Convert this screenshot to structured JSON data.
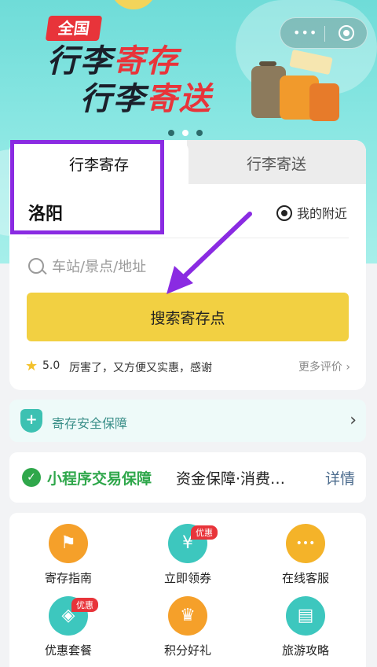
{
  "banner": {
    "badge": "全国",
    "line1_a": "行李",
    "line1_b": "寄存",
    "line2_a": "行李",
    "line2_b": "寄送",
    "slide_count": 3,
    "active_slide": 1
  },
  "capsule": {
    "more": "•••",
    "close_icon": "target-icon"
  },
  "tabs": [
    {
      "label": "行李寄存",
      "active": true
    },
    {
      "label": "行李寄送",
      "active": false
    }
  ],
  "location": {
    "city": "洛阳",
    "nearby_label": "我的附近"
  },
  "search": {
    "placeholder": "车站/景点/地址",
    "button_label": "搜索寄存点"
  },
  "rating": {
    "score": "5.0",
    "comment": "厉害了，又方便又实惠，感谢",
    "more": "更多评价 ›"
  },
  "safety": {
    "label": "寄存安全保障"
  },
  "guarantee": {
    "title": "小程序交易保障",
    "desc": "资金保障·消费…",
    "detail": "详情"
  },
  "grid": [
    {
      "label": "寄存指南",
      "icon": "signpost-icon",
      "glyph": "⚑",
      "badge": ""
    },
    {
      "label": "立即领券",
      "icon": "coupon-icon",
      "glyph": "¥",
      "badge": "优惠"
    },
    {
      "label": "在线客服",
      "icon": "chat-icon",
      "glyph": "•••",
      "badge": ""
    },
    {
      "label": "优惠套餐",
      "icon": "tag-icon",
      "glyph": "◈",
      "badge": "优惠"
    },
    {
      "label": "积分好礼",
      "icon": "crown-icon",
      "glyph": "♛",
      "badge": ""
    },
    {
      "label": "旅游攻略",
      "icon": "guidebook-icon",
      "glyph": "▤",
      "badge": ""
    }
  ],
  "colors": {
    "accent_yellow": "#f2d042",
    "hero_teal": "#6fdcd8",
    "brand_red": "#e8343a",
    "annotation_purple": "#8a2be2"
  }
}
